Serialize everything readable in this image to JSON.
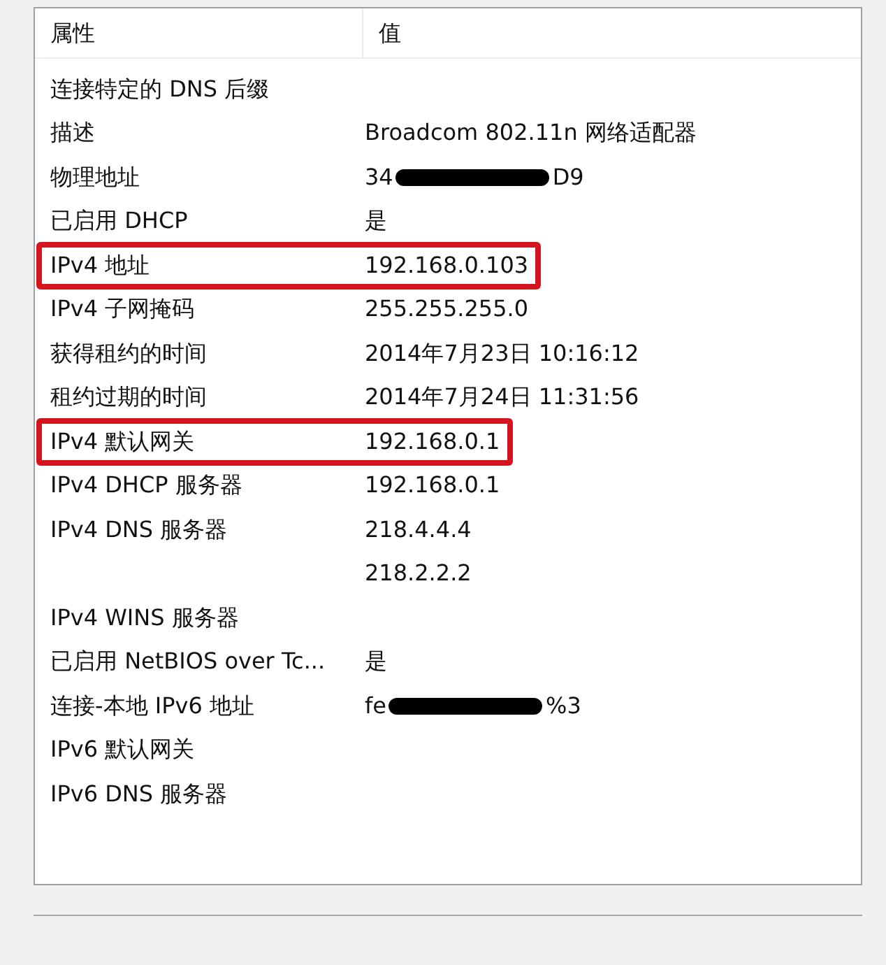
{
  "columns": [
    "属性",
    "值"
  ],
  "rows": [
    {
      "property": "连接特定的 DNS 后缀",
      "highlighted": false
    },
    {
      "property": "描述",
      "value": "Broadcom 802.11n 网络适配器",
      "highlighted": false
    },
    {
      "property": "物理地址",
      "value": "34",
      "value_end": "D9",
      "redacted": true,
      "highlighted": false
    },
    {
      "property": "已启用 DHCP",
      "value": "是",
      "highlighted": false
    },
    {
      "property": "IPv4 地址",
      "value": "192.168.0.103",
      "highlighted": true
    },
    {
      "property": "IPv4 子网掩码",
      "value": "255.255.255.0",
      "highlighted": false
    },
    {
      "property": "获得租约的时间",
      "value": "2014年7月23日 10:16:12",
      "highlighted": false
    },
    {
      "property": "租约过期的时间",
      "value": "2014年7月24日 11:31:56",
      "highlighted": false
    },
    {
      "property": "IPv4 默认网关",
      "value": "192.168.0.1",
      "highlighted": true
    },
    {
      "property": "IPv4 DHCP 服务器",
      "value": "192.168.0.1",
      "highlighted": false
    },
    {
      "property": "IPv4 DNS 服务器",
      "value": "218.4.4.4",
      "highlighted": false
    },
    {
      "value": "218.2.2.2",
      "highlighted": false
    },
    {
      "property": "IPv4 WINS 服务器",
      "highlighted": false
    },
    {
      "property": "已启用 NetBIOS over Tc...",
      "value": "是",
      "highlighted": false
    },
    {
      "property": "连接-本地 IPv6 地址",
      "value": "fe",
      "value_end": "%3",
      "redacted": true,
      "highlighted": false
    },
    {
      "property": "IPv6 默认网关",
      "highlighted": false
    },
    {
      "property": "IPv6 DNS 服务器",
      "highlighted": false
    }
  ]
}
